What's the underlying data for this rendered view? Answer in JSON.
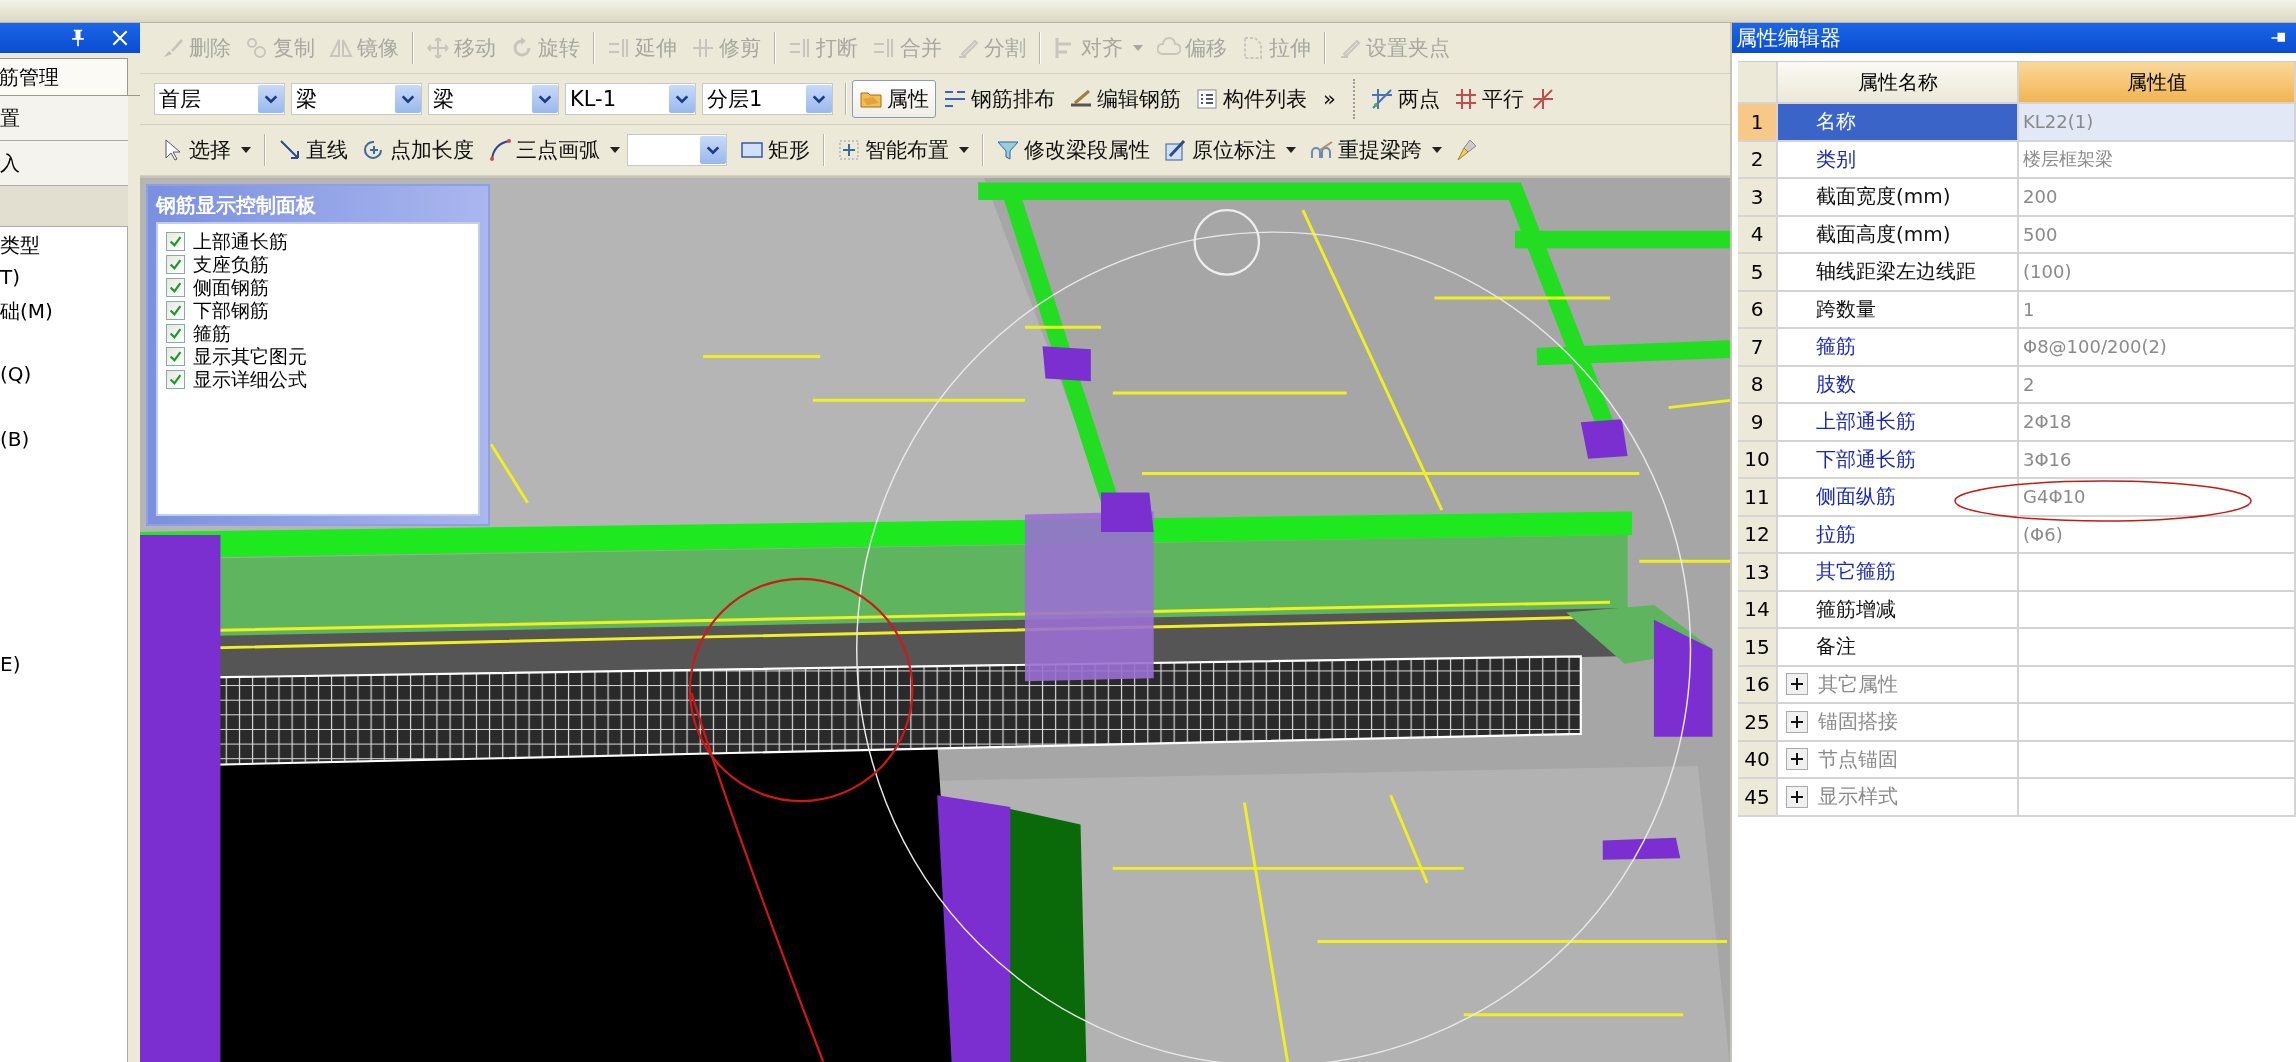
{
  "left_panel": {
    "tab": "筋管理",
    "sections": [
      "置",
      "入"
    ],
    "tree": [
      "类型",
      "T)",
      "础(M)",
      "(Q)",
      "(B)",
      "E)"
    ]
  },
  "toolbar_edit": [
    [
      {
        "label": "删除",
        "disabled": true
      },
      {
        "label": "复制",
        "disabled": true
      },
      {
        "label": "镜像",
        "disabled": true
      }
    ],
    [
      {
        "label": "移动",
        "disabled": true
      },
      {
        "label": "旋转",
        "disabled": true
      }
    ],
    [
      {
        "label": "延伸",
        "disabled": true
      },
      {
        "label": "修剪",
        "disabled": true
      }
    ],
    [
      {
        "label": "打断",
        "disabled": true
      },
      {
        "label": "合并",
        "disabled": true
      },
      {
        "label": "分割",
        "disabled": true
      }
    ],
    [
      {
        "label": "对齐",
        "disabled": true,
        "menu": true
      },
      {
        "label": "偏移",
        "disabled": true
      },
      {
        "label": "拉伸",
        "disabled": true
      }
    ],
    [
      {
        "label": "设置夹点",
        "disabled": true
      }
    ]
  ],
  "selectors": [
    {
      "value": "首层"
    },
    {
      "value": "梁"
    },
    {
      "value": "梁"
    },
    {
      "value": "KL-1"
    },
    {
      "value": "分层1"
    }
  ],
  "view_buttons": [
    {
      "label": "属性",
      "selected": true
    },
    {
      "label": "钢筋排布",
      "selected": false
    },
    {
      "label": "编辑钢筋",
      "selected": false
    },
    {
      "label": "构件列表",
      "selected": false
    }
  ],
  "overflow": "»",
  "axis_buttons": [
    {
      "label": "两点"
    },
    {
      "label": "平行"
    }
  ],
  "toolbar_draw": [
    [
      {
        "kind": "button",
        "label": "选择",
        "menu": true
      }
    ],
    [
      {
        "kind": "button",
        "label": "直线",
        "menu": false
      },
      {
        "kind": "button",
        "label": "点加长度",
        "menu": false
      },
      {
        "kind": "button",
        "label": "三点画弧",
        "menu": true
      },
      {
        "kind": "dropdown"
      },
      {
        "kind": "button",
        "label": "矩形",
        "menu": false
      }
    ],
    [
      {
        "kind": "button",
        "label": "智能布置",
        "menu": true
      }
    ],
    [
      {
        "kind": "button",
        "label": "修改梁段属性",
        "menu": false
      },
      {
        "kind": "button",
        "label": "原位标注",
        "menu": true
      },
      {
        "kind": "button",
        "label": "重提梁跨",
        "menu": true
      },
      {
        "kind": "icon"
      }
    ]
  ],
  "rebar_panel": {
    "title": "钢筋显示控制面板",
    "options": [
      {
        "label": "上部通长筋",
        "checked": true
      },
      {
        "label": "支座负筋",
        "checked": true
      },
      {
        "label": "侧面钢筋",
        "checked": true
      },
      {
        "label": "下部钢筋",
        "checked": true
      },
      {
        "label": "箍筋",
        "checked": true
      },
      {
        "label": "显示其它图元",
        "checked": true
      },
      {
        "label": "显示详细公式",
        "checked": true
      }
    ]
  },
  "property_editor": {
    "title": "属性编辑器",
    "columns": [
      "属性名称",
      "属性值"
    ],
    "rows": [
      {
        "index": "1",
        "name": "名称",
        "value": "KL22(1)",
        "kind": "public",
        "selected": true
      },
      {
        "index": "2",
        "name": "类别",
        "value": "楼层框架梁",
        "kind": "public",
        "selected": false
      },
      {
        "index": "3",
        "name": "截面宽度(mm)",
        "value": "200",
        "kind": "private",
        "selected": false
      },
      {
        "index": "4",
        "name": "截面高度(mm)",
        "value": "500",
        "kind": "private",
        "selected": false
      },
      {
        "index": "5",
        "name": "轴线距梁左边线距",
        "value": "(100)",
        "kind": "private",
        "selected": false
      },
      {
        "index": "6",
        "name": "跨数量",
        "value": "1",
        "kind": "private",
        "selected": false
      },
      {
        "index": "7",
        "name": "箍筋",
        "value": "Φ8@100/200(2)",
        "kind": "public",
        "selected": false
      },
      {
        "index": "8",
        "name": "肢数",
        "value": "2",
        "kind": "public",
        "selected": false
      },
      {
        "index": "9",
        "name": "上部通长筋",
        "value": "2Φ18",
        "kind": "public",
        "selected": false
      },
      {
        "index": "10",
        "name": "下部通长筋",
        "value": "3Φ16",
        "kind": "public",
        "selected": false
      },
      {
        "index": "11",
        "name": "侧面纵筋",
        "value": "G4Φ10",
        "kind": "public",
        "selected": false
      },
      {
        "index": "12",
        "name": "拉筋",
        "value": "(Φ6)",
        "kind": "public",
        "selected": false
      },
      {
        "index": "13",
        "name": "其它箍筋",
        "kind": "public",
        "selected": false
      },
      {
        "index": "14",
        "name": "箍筋增减",
        "kind": "private",
        "selected": false
      },
      {
        "index": "15",
        "name": "备注",
        "kind": "private",
        "selected": false
      },
      {
        "index": "16",
        "name": "其它属性",
        "kind": "group",
        "expanded": false,
        "selected": false
      },
      {
        "index": "25",
        "name": "锚固搭接",
        "kind": "group",
        "expanded": false,
        "selected": false
      },
      {
        "index": "40",
        "name": "节点锚固",
        "kind": "group",
        "expanded": false,
        "selected": false
      },
      {
        "index": "45",
        "name": "显示样式",
        "kind": "group",
        "expanded": false,
        "selected": false
      }
    ]
  }
}
